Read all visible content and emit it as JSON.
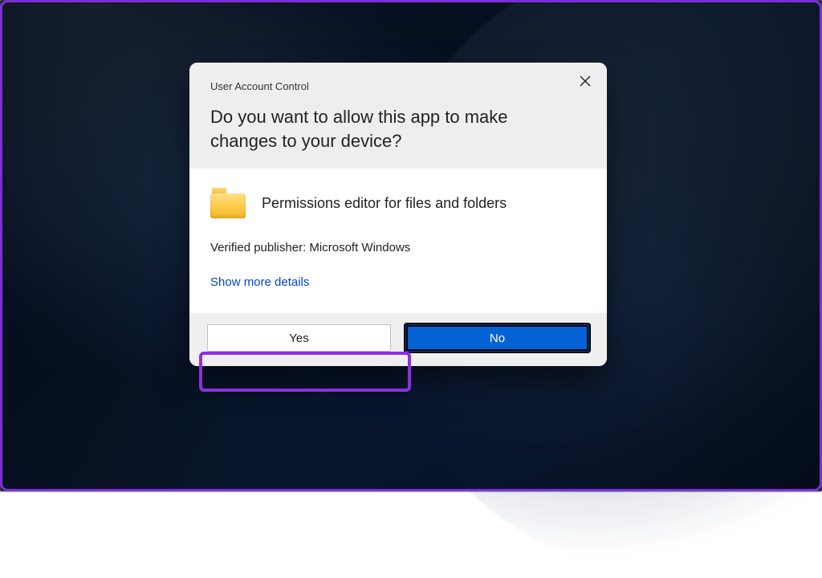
{
  "dialog": {
    "caption": "User Account Control",
    "headline": "Do you want to allow this app to make changes to your device?",
    "app_name": "Permissions editor for files and folders",
    "publisher_line": "Verified publisher: Microsoft Windows",
    "details_link": "Show more details",
    "buttons": {
      "yes": "Yes",
      "no": "No"
    }
  }
}
